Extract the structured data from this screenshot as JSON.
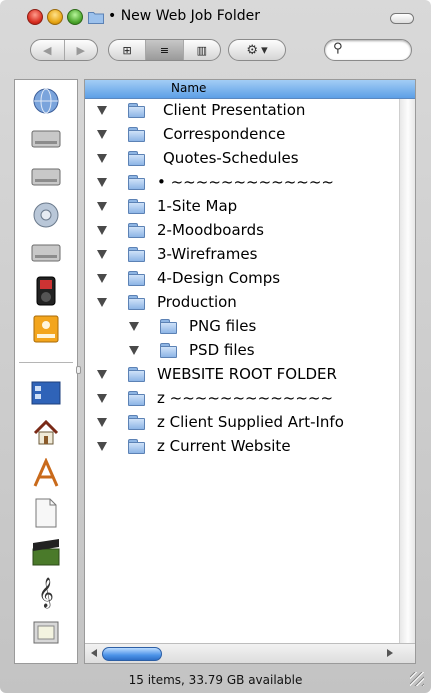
{
  "window": {
    "title": "• New Web Job Folder"
  },
  "toolbar": {
    "back_icon": "◀",
    "forward_icon": "▶",
    "view_icon_glyph": "⊞",
    "view_list_glyph": "≡",
    "view_column_glyph": "▥",
    "action_glyph": "⚙",
    "action_arrow": "▾",
    "search_glyph": "⚲"
  },
  "sidebar": {
    "items": [
      {
        "icon": "network-globe-icon",
        "glyph": "🌐"
      },
      {
        "icon": "hard-drive-icon",
        "glyph": "🖴"
      },
      {
        "icon": "hard-drive-icon",
        "glyph": "🖴"
      },
      {
        "icon": "network-drive-icon",
        "glyph": "🖧"
      },
      {
        "icon": "hard-drive-icon",
        "glyph": "🖴"
      },
      {
        "icon": "ipod-icon",
        "glyph": "▮"
      },
      {
        "icon": "external-drive-icon",
        "glyph": "▣"
      },
      {
        "icon": "desktop-icon",
        "glyph": "▤"
      },
      {
        "icon": "home-icon",
        "glyph": "⌂"
      },
      {
        "icon": "applications-icon",
        "glyph": "A"
      },
      {
        "icon": "documents-icon",
        "glyph": "🗋"
      },
      {
        "icon": "movies-icon",
        "glyph": "🎬"
      },
      {
        "icon": "music-icon",
        "glyph": "♫"
      },
      {
        "icon": "pictures-icon",
        "glyph": "▢"
      }
    ]
  },
  "list": {
    "column_header": "Name",
    "rows": [
      {
        "label": "Client Presentation",
        "indent": 0
      },
      {
        "label": "Correspondence",
        "indent": 0
      },
      {
        "label": "Quotes-Schedules",
        "indent": 0
      },
      {
        "label": "• ~~~~~~~~~~~~~",
        "indent": 0
      },
      {
        "label": "1-Site Map",
        "indent": 0
      },
      {
        "label": "2-Moodboards",
        "indent": 0
      },
      {
        "label": "3-Wireframes",
        "indent": 0
      },
      {
        "label": "4-Design Comps",
        "indent": 0
      },
      {
        "label": "Production",
        "indent": 0
      },
      {
        "label": "PNG files",
        "indent": 1
      },
      {
        "label": "PSD files",
        "indent": 1
      },
      {
        "label": "WEBSITE ROOT FOLDER",
        "indent": 0
      },
      {
        "label": "z  ~~~~~~~~~~~~~",
        "indent": 0
      },
      {
        "label": "z Client Supplied Art-Info",
        "indent": 0
      },
      {
        "label": "z Current Website",
        "indent": 0
      }
    ]
  },
  "status": {
    "text": "15 items, 33.79 GB available"
  }
}
